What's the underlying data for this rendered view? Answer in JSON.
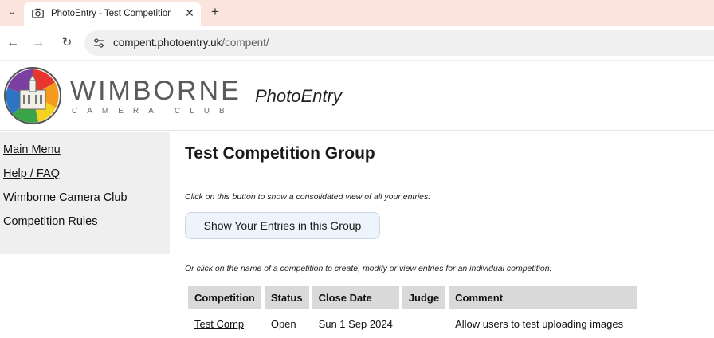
{
  "browser": {
    "tab_title": "PhotoEntry - Test Competition (",
    "url_host": "compent.photoentry.uk",
    "url_path": "/compent/"
  },
  "header": {
    "brand_main": "WIMBORNE",
    "brand_sub": "CAMERA CLUB",
    "app_name": "PhotoEntry"
  },
  "sidebar": {
    "items": [
      {
        "label": "Main Menu"
      },
      {
        "label": "Help / FAQ"
      },
      {
        "label": "Wimborne Camera Club"
      },
      {
        "label": "Competition Rules"
      }
    ]
  },
  "main": {
    "title": "Test Competition Group",
    "hint_consolidated": "Click on this button to show a consolidated view of all your entries:",
    "show_entries_label": "Show Your Entries in this Group",
    "hint_individual": "Or click on the name of a competition to create, modify or view entries for an individual competition:",
    "table": {
      "headers": [
        "Competition",
        "Status",
        "Close Date",
        "Judge",
        "Comment"
      ],
      "rows": [
        [
          "Test Comp",
          "Open",
          "Sun 1 Sep 2024",
          "",
          "Allow users to test uploading images"
        ]
      ]
    }
  },
  "colors": {
    "tabstrip": "#fbe3de",
    "sidebar": "#efefef",
    "button_bg": "#eef4fb",
    "table_header": "#d9d9d9"
  }
}
